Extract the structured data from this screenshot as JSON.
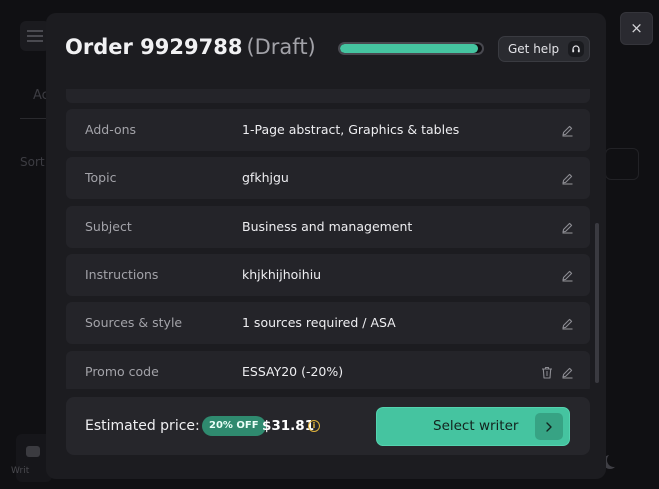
{
  "background": {
    "tab_text": "Ac",
    "sort_text": "Sort",
    "sidebar_text": "Writ"
  },
  "order": {
    "title": "Order 9929788",
    "status": "(Draft)",
    "progress_fraction": 0.97
  },
  "help": {
    "label": "Get help",
    "icon": "headset-icon"
  },
  "close": {
    "label": "×"
  },
  "details": [
    {
      "label": "Add-ons",
      "value": "1-Page abstract, Graphics & tables"
    },
    {
      "label": "Topic",
      "value": "gfkhjgu"
    },
    {
      "label": "Subject",
      "value": "Business and management"
    },
    {
      "label": "Instructions",
      "value": "khjkhijhoihiu"
    },
    {
      "label": "Sources & style",
      "value": "1 sources required / ASA"
    },
    {
      "label": "Promo code",
      "value": "ESSAY20 (-20%)"
    }
  ],
  "footer": {
    "estimated_label": "Estimated price:",
    "discount_badge": "20% OFF",
    "price": "$31.81",
    "info_icon": "i",
    "select_label": "Select writer"
  },
  "colors": {
    "accent": "#45c4a0",
    "warning": "#e0b33c",
    "modal_bg": "#1c1c20",
    "row_bg": "#242429"
  }
}
